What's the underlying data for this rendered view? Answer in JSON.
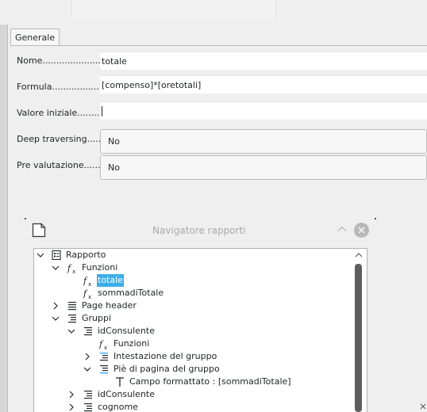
{
  "tab": {
    "label": "Generale"
  },
  "form": {
    "nome_label": "Nome......................",
    "nome_value": "totale",
    "formula_label": "Formula...................",
    "formula_value": "[compenso]*[oretotali]",
    "valore_label": "Valore iniziale.........",
    "valore_value": "",
    "deep_label": "Deep traversing.....",
    "deep_value": "No",
    "pre_label": "Pre valutazione.......",
    "pre_value": "No"
  },
  "navigator": {
    "title": "Navigatore rapporti",
    "tree": [
      {
        "label": "Rapporto",
        "icon": "report-icon",
        "expander": "expanded"
      },
      {
        "label": "Funzioni",
        "icon": "function-icon",
        "expander": "expanded"
      },
      {
        "label": "totale",
        "icon": "function-icon",
        "expander": "none",
        "selected": true
      },
      {
        "label": "sommadiTotale",
        "icon": "function-icon",
        "expander": "none"
      },
      {
        "label": "Page header",
        "icon": "section-icon",
        "expander": "collapsed"
      },
      {
        "label": "Gruppi",
        "icon": "group-list-icon",
        "expander": "expanded"
      },
      {
        "label": "idConsulente",
        "icon": "group-list-icon",
        "expander": "expanded"
      },
      {
        "label": "Funzioni",
        "icon": "function-icon",
        "expander": "none"
      },
      {
        "label": "Intestazione del gruppo",
        "icon": "group-header-icon",
        "expander": "collapsed"
      },
      {
        "label": "Piè di pagina del gruppo",
        "icon": "group-footer-icon",
        "expander": "expanded"
      },
      {
        "label": "Campo formattato : [sommadiTotale]",
        "icon": "text-field-icon",
        "expander": "none"
      },
      {
        "label": "idConsulente",
        "icon": "group-list-icon",
        "expander": "collapsed"
      },
      {
        "label": "cognome",
        "icon": "group-list-icon",
        "expander": "collapsed"
      }
    ]
  }
}
